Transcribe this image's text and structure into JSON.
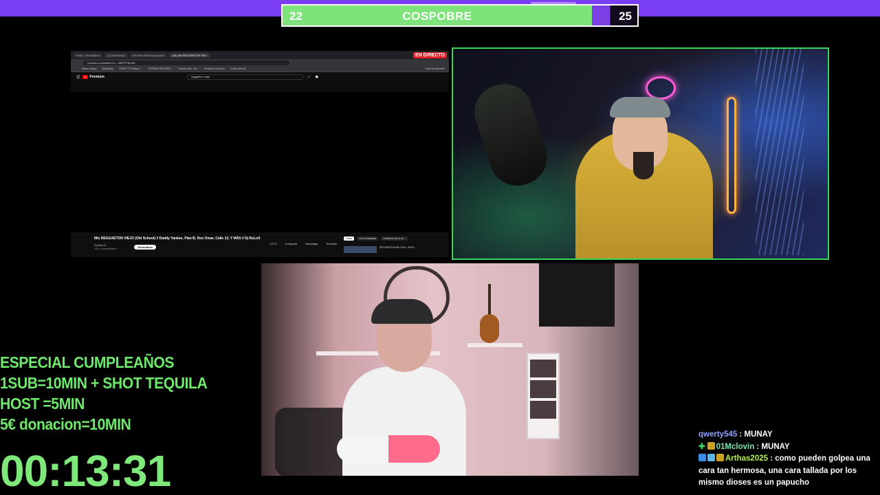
{
  "scorebar": {
    "left_score": "22",
    "title": "COSPOBRE",
    "right_score": "25",
    "left_fill_fraction": 0.88,
    "left_color": "#7ee37a",
    "right_color": "#7b3fe4"
  },
  "browser": {
    "tabs": [
      "Inicio - Est.dadipau",
      "((1) WhatsApp",
      "Reciclar Videos populares",
      "(26) Mix REGGAETON VIEJ"
    ],
    "live_badge": "EN DIRECTO",
    "url": "youtube.com/watch?v=...d8EF7P&t=85",
    "bookmarks": [
      "Nuevo campo",
      "WhatsApp",
      "YOUR TTV Fuego F...",
      "TOTRING DEVOS23...",
      "Cazado 20to - Bo...",
      "Prosesdo Fust sour",
      "a nuev ser tue",
      "Todos los favoritos"
    ],
    "yt_logo": "Premium",
    "search_query": "reggaeton viejo",
    "video_title": "Mix REGGAETON VIEJO (Old School) // Daddy Yankee, Plan B, Don Omar, Calle 13, Y MÁS // Dj RuLoX",
    "channel_name": "Dj RuLoX",
    "channel_subs": "141 k suscriptores",
    "subscribe_label": "Suscribirse",
    "actions": [
      "472 K",
      "Compartir",
      "Descargar",
      "Recortar"
    ],
    "chips": [
      "Todos",
      "De tu búsqueda",
      "Contenido de tu au..."
    ],
    "rec_title": "REGGAETON MIX 2024 - MIXE..."
  },
  "promo": {
    "lines": [
      "ESPECIAL CUMPLEAÑOS",
      "1SUB=10MIN + SHOT TEQUILA",
      "HOST =5MIN",
      "5€ donacion=10MIN"
    ]
  },
  "timer": "00:13:31",
  "chat": {
    "messages": [
      {
        "user": "qwerty545",
        "color": "#8fa3ff",
        "text": " : MUNAY"
      },
      {
        "user": "01Mclovin",
        "color": "#7ee8b0",
        "text": " : MUNAY"
      },
      {
        "user": "Arthas2025",
        "color": "#b6f04a",
        "text": " : como pueden golpea una cara tan hermosa, una cara tallada por los mismo dioses es un papucho"
      }
    ]
  },
  "colors": {
    "accent_green": "#6ee86a",
    "frame_green": "#37d657",
    "top_purple": "#7a3ff2"
  }
}
